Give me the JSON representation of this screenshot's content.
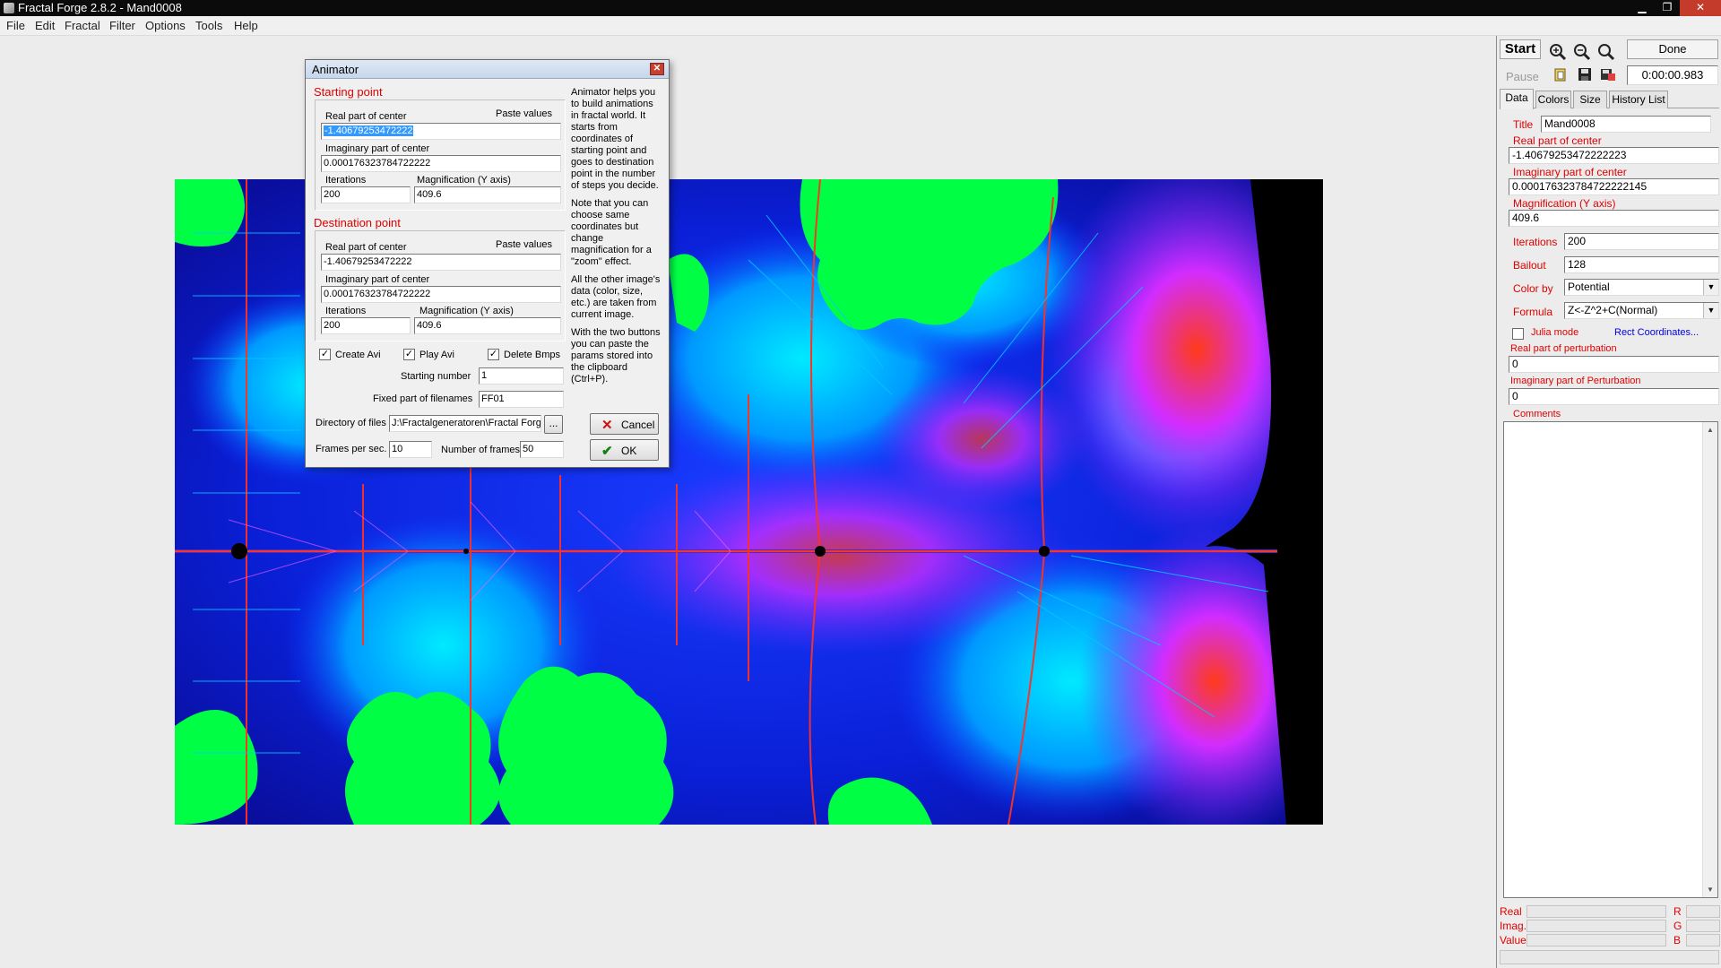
{
  "window": {
    "title": "Fractal Forge 2.8.2 - Mand0008"
  },
  "menu": [
    "File",
    "Edit",
    "Fractal",
    "Filter",
    "Options",
    "Tools",
    "Help"
  ],
  "toolbar": {
    "start": "Start",
    "pause": "Pause",
    "done": "Done",
    "timer": "0:00:00.983"
  },
  "tabs": [
    "Data",
    "Colors",
    "Size",
    "History List"
  ],
  "data_panel": {
    "title_label": "Title",
    "title_value": "Mand0008",
    "real_label": "Real part of center",
    "real_value": "-1.40679253472222223",
    "imag_label": "Imaginary part of center",
    "imag_value": "0.000176323784722222145",
    "mag_label": "Magnification (Y axis)",
    "mag_value": "409.6",
    "iter_label": "Iterations",
    "iter_value": "200",
    "bailout_label": "Bailout",
    "bailout_value": "128",
    "colorby_label": "Color by",
    "colorby_value": "Potential",
    "formula_label": "Formula",
    "formula_value": "Z<-Z^2+C(Normal)",
    "julia_label": "Julia mode",
    "rect_link": "Rect Coordinates...",
    "pert_real_label": "Real part of perturbation",
    "pert_real_value": "0",
    "pert_imag_label": "Imaginary part of Perturbation",
    "pert_imag_value": "0",
    "comments_label": "Comments"
  },
  "status": [
    {
      "label": "Real",
      "channel": "R"
    },
    {
      "label": "Imag.",
      "channel": "G"
    },
    {
      "label": "Value",
      "channel": "B"
    }
  ],
  "dialog": {
    "title": "Animator",
    "start_section": "Starting point",
    "dest_section": "Destination point",
    "real_label": "Real part of center",
    "paste": "Paste values",
    "imag_label": "Imaginary part of center",
    "iter_label": "Iterations",
    "mag_label": "Magnification (Y axis)",
    "start": {
      "real": "-1.40679253472222",
      "imag": "0.000176323784722222",
      "iter": "200",
      "mag": "409.6"
    },
    "dest": {
      "real": "-1.40679253472222",
      "imag": "0.000176323784722222",
      "iter": "200",
      "mag": "409.6"
    },
    "create_avi": "Create Avi",
    "play_avi": "Play Avi",
    "delete_bmps": "Delete Bmps",
    "starting_number_label": "Starting number",
    "starting_number": "1",
    "fixed_label": "Fixed part of filenames",
    "fixed_value": "FF01",
    "dir_label": "Directory of files",
    "dir_value": "J:\\Fractalgeneratoren\\Fractal Forg",
    "browse": "...",
    "fps_label": "Frames per sec.",
    "fps_value": "10",
    "frames_label": "Number of frames",
    "frames_value": "50",
    "cancel": "Cancel",
    "ok": "OK",
    "help": [
      "Animator helps you to build animations in fractal world. It starts from coordinates of starting point and goes to destination point in the number of steps you decide.",
      "Note that you can choose same coordinates but change magnification for a \"zoom\" effect.",
      "All the other image's data (color, size, etc.) are taken from current image.",
      "With the two buttons you can paste the params stored into the clipboard (Ctrl+P)."
    ]
  }
}
